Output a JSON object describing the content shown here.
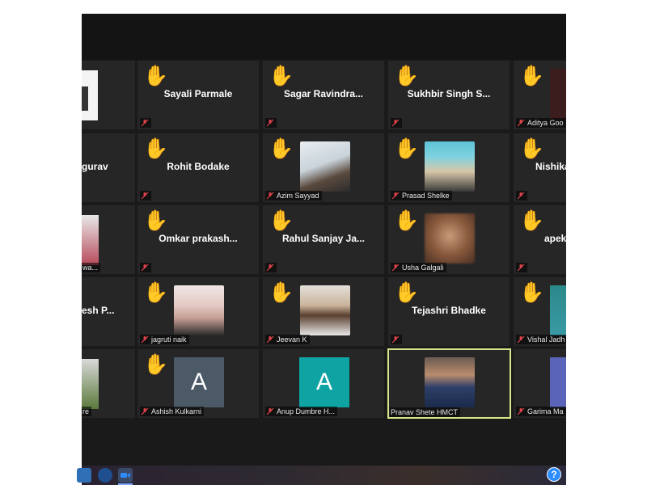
{
  "colors": {
    "background": "#1a1a1a",
    "tile": "#262626",
    "active_border": "#d6e68a",
    "raise_hand": "#f5c33b",
    "muted_mic": "#e0434b"
  },
  "icons": {
    "raise_hand": "raise-hand-icon",
    "muted": "mic-muted-icon",
    "help": "help-icon"
  },
  "participants": [
    {
      "name": "Sayali Parmale",
      "center": true,
      "raised": true
    },
    {
      "name": "Sagar Ravindra...",
      "center": true,
      "raised": true
    },
    {
      "name": "Sukhbir Singh S...",
      "center": true,
      "raised": true
    },
    {
      "name": "Aditya Goo",
      "center": false,
      "raised": true
    },
    {
      "name": "gurav",
      "center": true,
      "raised": false
    },
    {
      "name": "Rohit Bodake",
      "center": true,
      "raised": true
    },
    {
      "name": "Azim Sayyad",
      "center": false,
      "raised": true
    },
    {
      "name": "Prasad Shelke",
      "center": false,
      "raised": true
    },
    {
      "name": "Nishika",
      "center": true,
      "raised": true
    },
    {
      "name": "wa...",
      "center": false,
      "raised": false
    },
    {
      "name": "Omkar prakash...",
      "center": true,
      "raised": true
    },
    {
      "name": "Rahul Sanjay Ja...",
      "center": true,
      "raised": true
    },
    {
      "name": "Usha Galgali",
      "center": false,
      "raised": true
    },
    {
      "name": "apeks",
      "center": true,
      "raised": true
    },
    {
      "name": "esh P...",
      "center": true,
      "raised": false
    },
    {
      "name": "jagruti naik",
      "center": false,
      "raised": true
    },
    {
      "name": "Jeevan K",
      "center": false,
      "raised": true
    },
    {
      "name": "Tejashri Bhadke",
      "center": true,
      "raised": true
    },
    {
      "name": "Vishal Jadh",
      "center": false,
      "raised": true
    },
    {
      "name": "re",
      "center": false,
      "raised": false
    },
    {
      "name": "Ashish Kulkarni",
      "center": false,
      "raised": true,
      "avatar": "A"
    },
    {
      "name": "Anup Dumbre H...",
      "center": false,
      "raised": false,
      "avatar": "A"
    },
    {
      "name": "Pranav Shete HMCT",
      "center": false,
      "raised": false,
      "active": true
    },
    {
      "name": "Garima Ma",
      "center": false,
      "raised": false
    }
  ],
  "help_label": "?"
}
